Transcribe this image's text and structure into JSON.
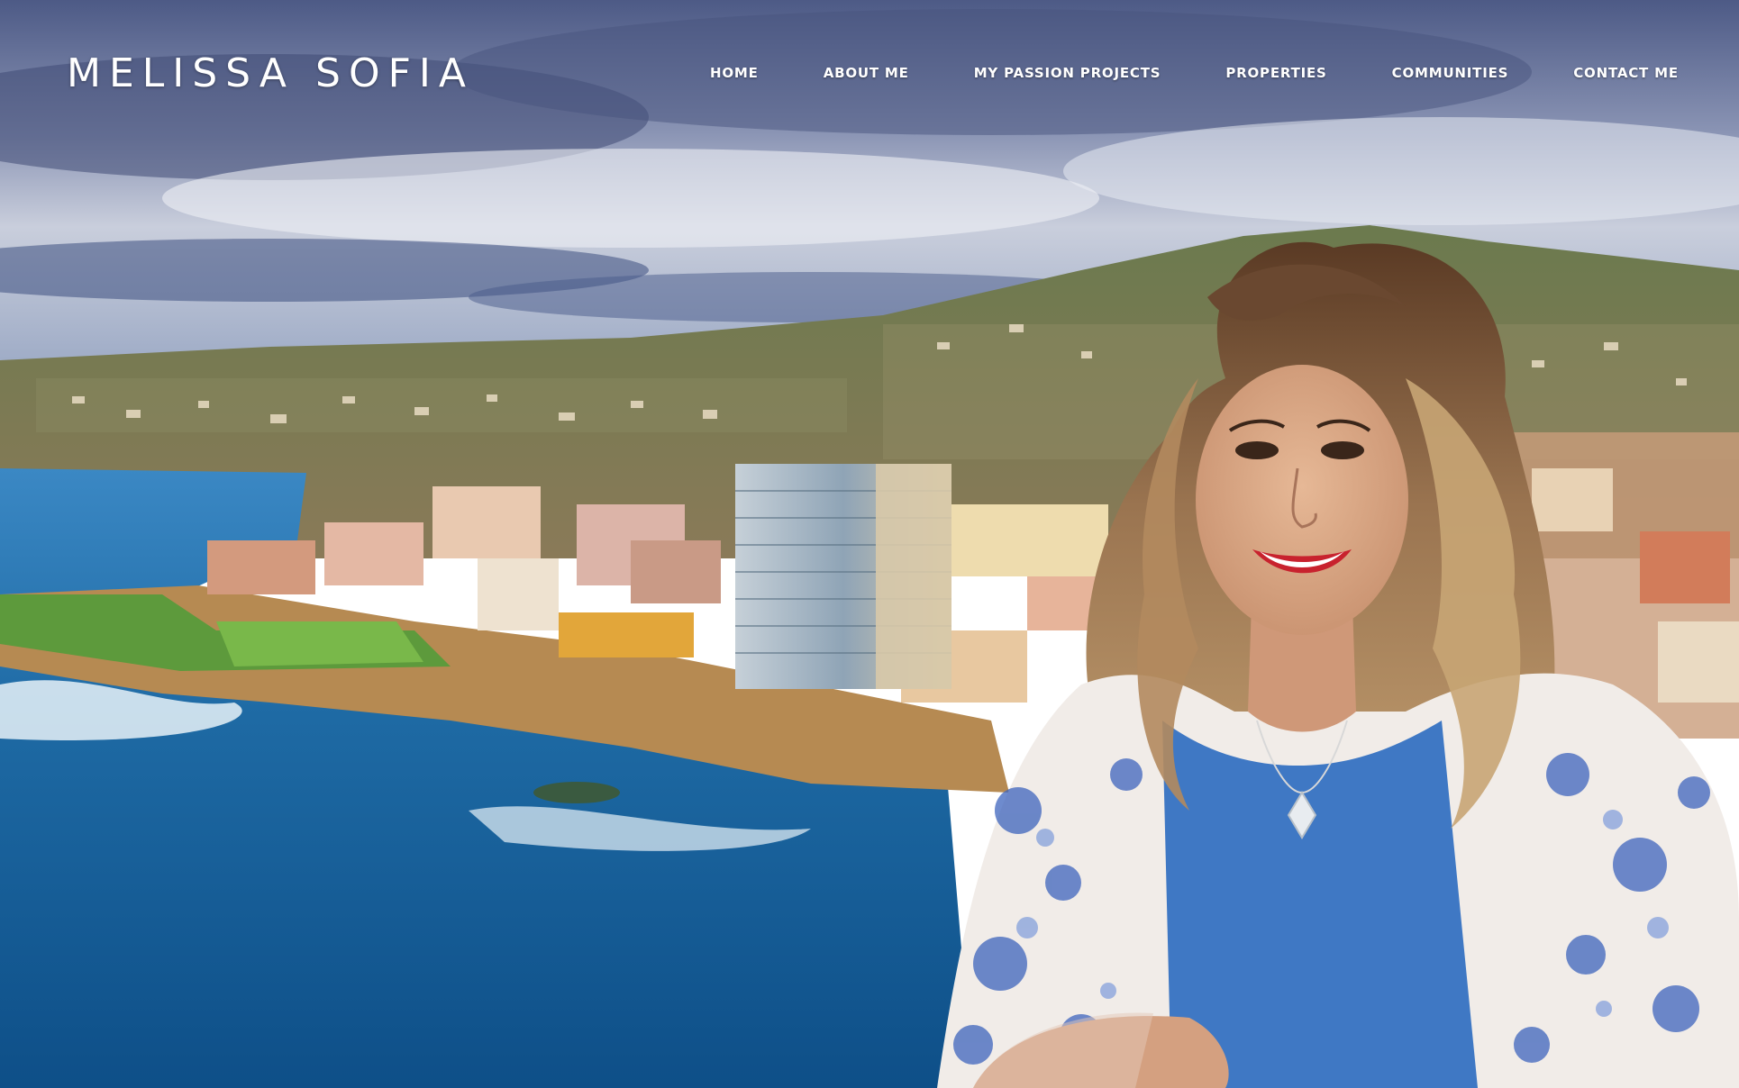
{
  "site": {
    "logo_text": "MELISSA SOFIA"
  },
  "nav": {
    "items": [
      {
        "label": "HOME"
      },
      {
        "label": "ABOUT ME"
      },
      {
        "label": "MY PASSION PROJECTS"
      },
      {
        "label": "PROPERTIES"
      },
      {
        "label": "COMMUNITIES"
      },
      {
        "label": "CONTACT ME"
      }
    ]
  },
  "colors": {
    "nav_text": "#ffffff",
    "sky": "#5d6f9c",
    "ocean": "#1f6fa5",
    "dress": "#3f78c4"
  },
  "hero": {
    "image_content": "coastal city aerial with portrait of smiling woman"
  }
}
